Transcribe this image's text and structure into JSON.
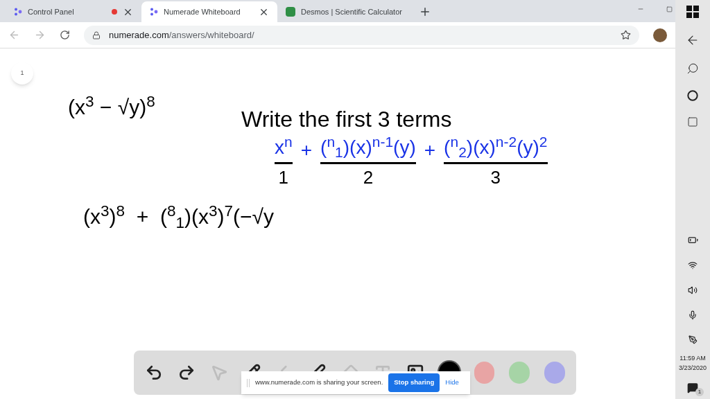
{
  "tabs": [
    {
      "label": "Control Panel",
      "selected": false,
      "recording": true,
      "kind": "numerade"
    },
    {
      "label": "Numerade Whiteboard",
      "selected": true,
      "recording": false,
      "kind": "numerade"
    },
    {
      "label": "Desmos | Scientific Calculator",
      "selected": false,
      "recording": false,
      "kind": "desmos"
    }
  ],
  "address": {
    "domain": "numerade.com",
    "path": "/answers/whiteboard/"
  },
  "whiteboard": {
    "page": "1",
    "problem": "(x$^{3}$ − √y)$^{8}$",
    "instruction": "Write the first 3 terms",
    "terms": [
      {
        "text": "x$^{n}$",
        "label": "1"
      },
      {
        "text": "($^{n}$$_{1}$)(x)$^{n-1}$(y)",
        "label": "2"
      },
      {
        "text": "($^{n}$$_{2}$)(x)$^{n-2}$(y)$^{2}$",
        "label": "3"
      }
    ],
    "plus": "+",
    "work": "(x$^{3}$)$^{8}$  +  ($^{8}$$_{1}$)(x$^{3}$)$^{7}$(−√y"
  },
  "toolbar": {
    "tools": [
      {
        "kind": "undo",
        "disabled": false
      },
      {
        "kind": "redo",
        "disabled": false
      },
      {
        "kind": "pointer",
        "disabled": true
      },
      {
        "kind": "pen",
        "disabled": false
      },
      {
        "kind": "highlighter",
        "disabled": true
      },
      {
        "kind": "line",
        "disabled": false
      },
      {
        "kind": "eraser",
        "disabled": true
      },
      {
        "kind": "text",
        "disabled": true
      },
      {
        "kind": "image",
        "disabled": false
      }
    ],
    "colors": [
      {
        "color": "#000000",
        "selected": true
      },
      {
        "color": "#e8a4a4",
        "selected": false
      },
      {
        "color": "#a6d4a6",
        "selected": false
      },
      {
        "color": "#a9a9e9",
        "selected": false
      }
    ]
  },
  "share_banner": {
    "message": "www.numerade.com is sharing your screen.",
    "stop": "Stop sharing",
    "hide": "Hide"
  },
  "taskbar": {
    "time": "11:59 AM",
    "date": "3/23/2020",
    "notifications": "1"
  }
}
